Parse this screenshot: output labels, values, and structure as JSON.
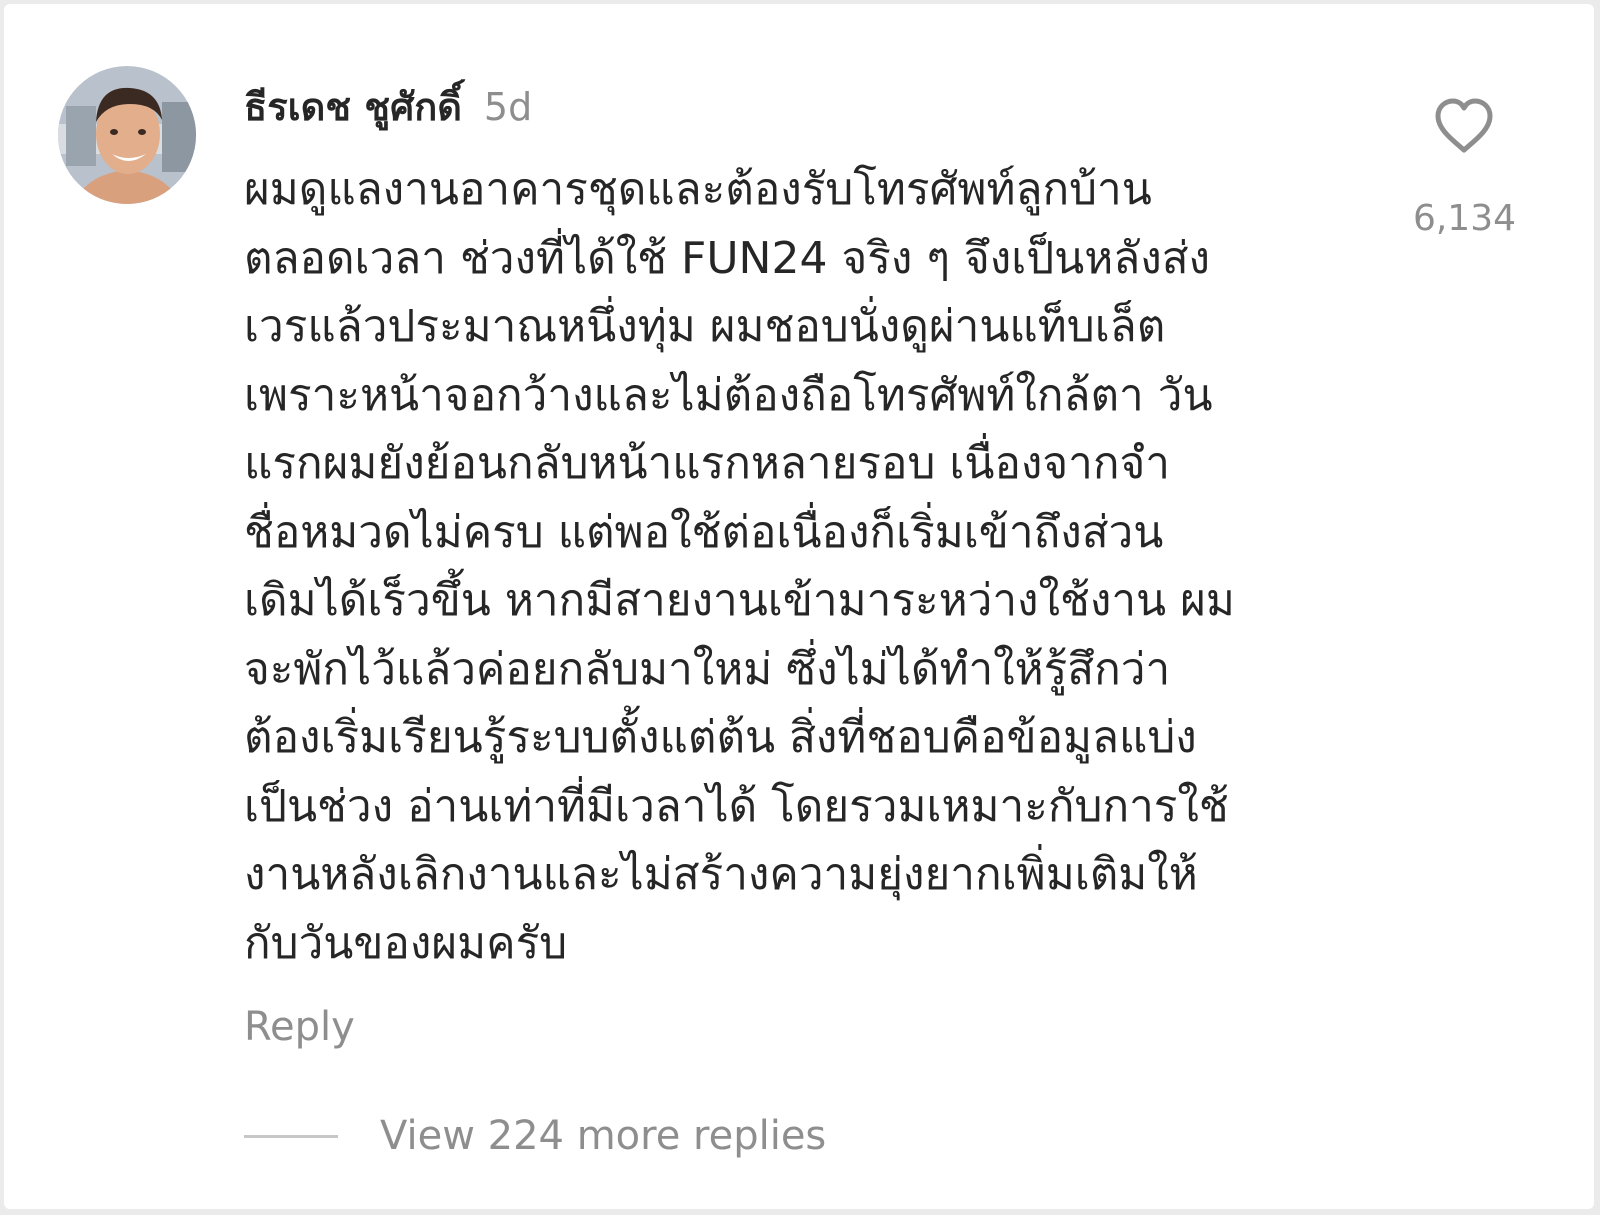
{
  "comment": {
    "avatar": {
      "icon": "profile-photo"
    },
    "username": "ธีรเดช ชูศักดิ์",
    "timestamp": "5d",
    "body_lines": [
      "ผมดูแลงานอาคารชุดและต้องรับโทรศัพท์ลูกบ้าน",
      "ตลอดเวลา ช่วงที่ได้ใช้ FUN24 จริง ๆ จึงเป็นหลังส่ง",
      "เวรแล้วประมาณหนึ่งทุ่ม ผมชอบนั่งดูผ่านแท็บเล็ต",
      "เพราะหน้าจอกว้างและไม่ต้องถือโทรศัพท์ใกล้ตา วัน",
      "แรกผมยังย้อนกลับหน้าแรกหลายรอบ เนื่องจากจำ",
      "ชื่อหมวดไม่ครบ แต่พอใช้ต่อเนื่องก็เริ่มเข้าถึงส่วน",
      "เดิมได้เร็วขึ้น หากมีสายงานเข้ามาระหว่างใช้งาน ผม",
      "จะพักไว้แล้วค่อยกลับมาใหม่ ซึ่งไม่ได้ทำให้รู้สึกว่า",
      "ต้องเริ่มเรียนรู้ระบบตั้งแต่ต้น สิ่งที่ชอบคือข้อมูลแบ่ง",
      "เป็นช่วง อ่านเท่าที่มีเวลาได้ โดยรวมเหมาะกับการใช้",
      "งานหลังเลิกงานและไม่สร้างความยุ่งยากเพิ่มเติมให้",
      "กับวันของผมครับ"
    ],
    "like": {
      "icon": "heart-outline-icon",
      "count": "6,134"
    },
    "reply_label": "Reply",
    "view_replies_label": "View 224 more replies"
  },
  "colors": {
    "text_primary": "#262626",
    "text_secondary": "#8e8e8e",
    "divider": "#c7c7c7",
    "background": "#ffffff"
  }
}
